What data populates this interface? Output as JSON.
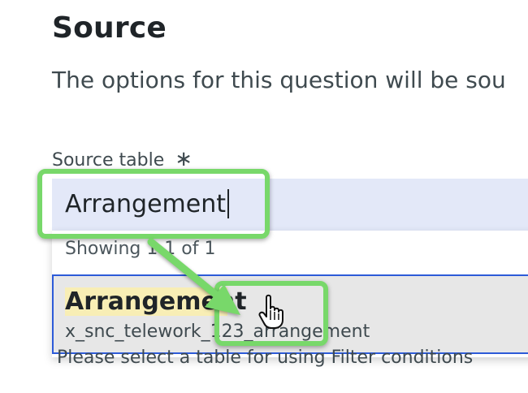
{
  "section": {
    "title": "Source",
    "description": "The options for this question will be sou"
  },
  "source_table": {
    "label": "Source table",
    "required_marker": "∗",
    "input_value": "Arrangement"
  },
  "dropdown": {
    "count_text": "Showing 1-1 of 1",
    "options": [
      {
        "label": "Arrangement",
        "sublabel": "x_snc_telework_123_arrangement"
      }
    ]
  },
  "help_text": "Please select a table for using Filter conditions",
  "annotation": {
    "highlight_color": "#78d86a",
    "cursor_icon": "hand-pointer-icon"
  }
}
